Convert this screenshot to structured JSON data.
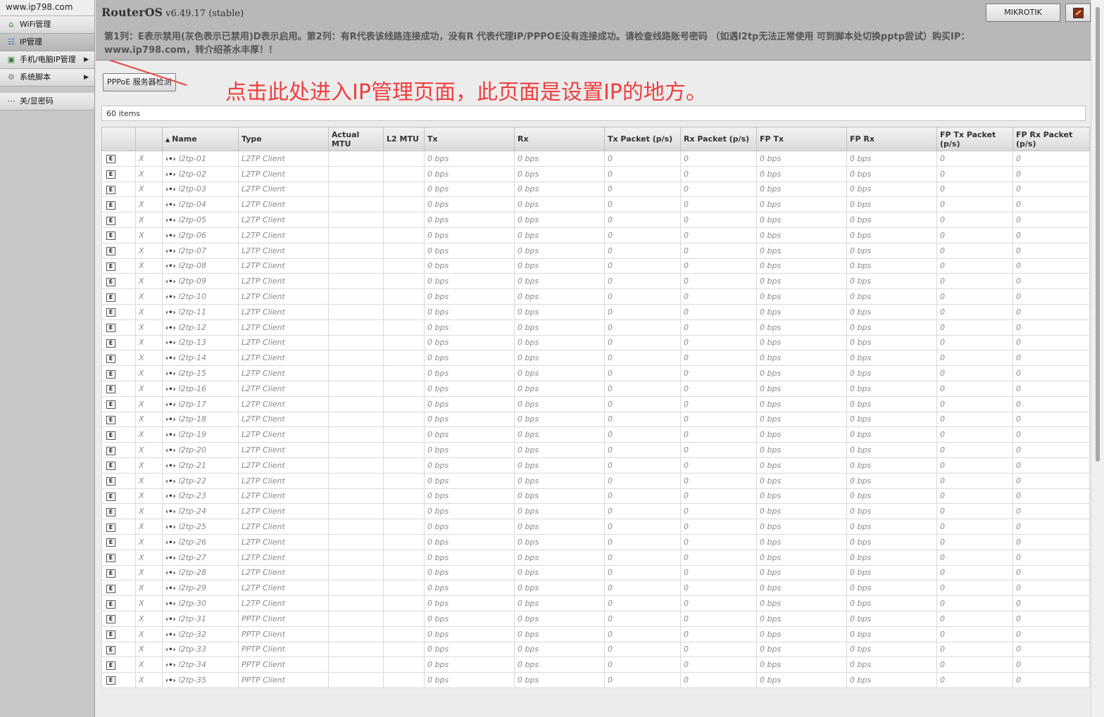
{
  "sidebar": {
    "site": "www.ip798.com",
    "items": [
      {
        "label": "WiFi管理",
        "icon": "wifi-icon",
        "has_submenu": false,
        "active": false
      },
      {
        "label": "IP管理",
        "icon": "network-icon",
        "has_submenu": false,
        "active": true
      },
      {
        "label": "手机/电脑IP管理",
        "icon": "computer-icon",
        "has_submenu": true,
        "active": false
      },
      {
        "label": "系统脚本",
        "icon": "gear-icon",
        "has_submenu": true,
        "active": false
      }
    ],
    "password_item": {
      "label": "关/显密码",
      "icon": "password-dots-icon"
    }
  },
  "header": {
    "title": "RouterOS",
    "version": "v6.49.17 (stable)",
    "identity": "MIKROTIK",
    "notice": "第1列：E表示禁用(灰色表示已禁用)D表示启用。第2列：有R代表该线路连接成功，没有R 代表代理IP/PPPOE没有连接成功。请检查线路账号密码 （如遇l2tp无法正常使用 可到脚本处切换pptp尝试）购买IP：www.ip798.com，转介绍茶水丰厚！！"
  },
  "toolbar": {
    "pppoe_button": "PPPoE 服务器检测"
  },
  "annotation": "点击此处进入IP管理页面，此页面是设置IP的地方。",
  "table": {
    "count_label": "60 items",
    "sort_indicator": "▲",
    "columns": [
      "",
      "",
      "Name",
      "Type",
      "Actual MTU",
      "L2 MTU",
      "Tx",
      "Rx",
      "Tx Packet (p/s)",
      "Rx Packet (p/s)",
      "FP Tx",
      "FP Rx",
      "FP Tx Packet (p/s)",
      "FP Rx Packet (p/s)"
    ],
    "rows": [
      {
        "flag": "X",
        "name": "l2tp-01",
        "type": "L2TP Client",
        "tx": "0 bps",
        "rx": "0 bps",
        "txp": "0",
        "rxp": "0",
        "fptx": "0 bps",
        "fprx": "0 bps",
        "fptxp": "0",
        "fprxp": "0"
      },
      {
        "flag": "X",
        "name": "l2tp-02",
        "type": "L2TP Client",
        "tx": "0 bps",
        "rx": "0 bps",
        "txp": "0",
        "rxp": "0",
        "fptx": "0 bps",
        "fprx": "0 bps",
        "fptxp": "0",
        "fprxp": "0"
      },
      {
        "flag": "X",
        "name": "l2tp-03",
        "type": "L2TP Client",
        "tx": "0 bps",
        "rx": "0 bps",
        "txp": "0",
        "rxp": "0",
        "fptx": "0 bps",
        "fprx": "0 bps",
        "fptxp": "0",
        "fprxp": "0"
      },
      {
        "flag": "X",
        "name": "l2tp-04",
        "type": "L2TP Client",
        "tx": "0 bps",
        "rx": "0 bps",
        "txp": "0",
        "rxp": "0",
        "fptx": "0 bps",
        "fprx": "0 bps",
        "fptxp": "0",
        "fprxp": "0"
      },
      {
        "flag": "X",
        "name": "l2tp-05",
        "type": "L2TP Client",
        "tx": "0 bps",
        "rx": "0 bps",
        "txp": "0",
        "rxp": "0",
        "fptx": "0 bps",
        "fprx": "0 bps",
        "fptxp": "0",
        "fprxp": "0"
      },
      {
        "flag": "X",
        "name": "l2tp-06",
        "type": "L2TP Client",
        "tx": "0 bps",
        "rx": "0 bps",
        "txp": "0",
        "rxp": "0",
        "fptx": "0 bps",
        "fprx": "0 bps",
        "fptxp": "0",
        "fprxp": "0"
      },
      {
        "flag": "X",
        "name": "l2tp-07",
        "type": "L2TP Client",
        "tx": "0 bps",
        "rx": "0 bps",
        "txp": "0",
        "rxp": "0",
        "fptx": "0 bps",
        "fprx": "0 bps",
        "fptxp": "0",
        "fprxp": "0"
      },
      {
        "flag": "X",
        "name": "l2tp-08",
        "type": "L2TP Client",
        "tx": "0 bps",
        "rx": "0 bps",
        "txp": "0",
        "rxp": "0",
        "fptx": "0 bps",
        "fprx": "0 bps",
        "fptxp": "0",
        "fprxp": "0"
      },
      {
        "flag": "X",
        "name": "l2tp-09",
        "type": "L2TP Client",
        "tx": "0 bps",
        "rx": "0 bps",
        "txp": "0",
        "rxp": "0",
        "fptx": "0 bps",
        "fprx": "0 bps",
        "fptxp": "0",
        "fprxp": "0"
      },
      {
        "flag": "X",
        "name": "l2tp-10",
        "type": "L2TP Client",
        "tx": "0 bps",
        "rx": "0 bps",
        "txp": "0",
        "rxp": "0",
        "fptx": "0 bps",
        "fprx": "0 bps",
        "fptxp": "0",
        "fprxp": "0"
      },
      {
        "flag": "X",
        "name": "l2tp-11",
        "type": "L2TP Client",
        "tx": "0 bps",
        "rx": "0 bps",
        "txp": "0",
        "rxp": "0",
        "fptx": "0 bps",
        "fprx": "0 bps",
        "fptxp": "0",
        "fprxp": "0"
      },
      {
        "flag": "X",
        "name": "l2tp-12",
        "type": "L2TP Client",
        "tx": "0 bps",
        "rx": "0 bps",
        "txp": "0",
        "rxp": "0",
        "fptx": "0 bps",
        "fprx": "0 bps",
        "fptxp": "0",
        "fprxp": "0"
      },
      {
        "flag": "X",
        "name": "l2tp-13",
        "type": "L2TP Client",
        "tx": "0 bps",
        "rx": "0 bps",
        "txp": "0",
        "rxp": "0",
        "fptx": "0 bps",
        "fprx": "0 bps",
        "fptxp": "0",
        "fprxp": "0"
      },
      {
        "flag": "X",
        "name": "l2tp-14",
        "type": "L2TP Client",
        "tx": "0 bps",
        "rx": "0 bps",
        "txp": "0",
        "rxp": "0",
        "fptx": "0 bps",
        "fprx": "0 bps",
        "fptxp": "0",
        "fprxp": "0"
      },
      {
        "flag": "X",
        "name": "l2tp-15",
        "type": "L2TP Client",
        "tx": "0 bps",
        "rx": "0 bps",
        "txp": "0",
        "rxp": "0",
        "fptx": "0 bps",
        "fprx": "0 bps",
        "fptxp": "0",
        "fprxp": "0"
      },
      {
        "flag": "X",
        "name": "l2tp-16",
        "type": "L2TP Client",
        "tx": "0 bps",
        "rx": "0 bps",
        "txp": "0",
        "rxp": "0",
        "fptx": "0 bps",
        "fprx": "0 bps",
        "fptxp": "0",
        "fprxp": "0"
      },
      {
        "flag": "X",
        "name": "l2tp-17",
        "type": "L2TP Client",
        "tx": "0 bps",
        "rx": "0 bps",
        "txp": "0",
        "rxp": "0",
        "fptx": "0 bps",
        "fprx": "0 bps",
        "fptxp": "0",
        "fprxp": "0"
      },
      {
        "flag": "X",
        "name": "l2tp-18",
        "type": "L2TP Client",
        "tx": "0 bps",
        "rx": "0 bps",
        "txp": "0",
        "rxp": "0",
        "fptx": "0 bps",
        "fprx": "0 bps",
        "fptxp": "0",
        "fprxp": "0"
      },
      {
        "flag": "X",
        "name": "l2tp-19",
        "type": "L2TP Client",
        "tx": "0 bps",
        "rx": "0 bps",
        "txp": "0",
        "rxp": "0",
        "fptx": "0 bps",
        "fprx": "0 bps",
        "fptxp": "0",
        "fprxp": "0"
      },
      {
        "flag": "X",
        "name": "l2tp-20",
        "type": "L2TP Client",
        "tx": "0 bps",
        "rx": "0 bps",
        "txp": "0",
        "rxp": "0",
        "fptx": "0 bps",
        "fprx": "0 bps",
        "fptxp": "0",
        "fprxp": "0"
      },
      {
        "flag": "X",
        "name": "l2tp-21",
        "type": "L2TP Client",
        "tx": "0 bps",
        "rx": "0 bps",
        "txp": "0",
        "rxp": "0",
        "fptx": "0 bps",
        "fprx": "0 bps",
        "fptxp": "0",
        "fprxp": "0"
      },
      {
        "flag": "X",
        "name": "l2tp-22",
        "type": "L2TP Client",
        "tx": "0 bps",
        "rx": "0 bps",
        "txp": "0",
        "rxp": "0",
        "fptx": "0 bps",
        "fprx": "0 bps",
        "fptxp": "0",
        "fprxp": "0"
      },
      {
        "flag": "X",
        "name": "l2tp-23",
        "type": "L2TP Client",
        "tx": "0 bps",
        "rx": "0 bps",
        "txp": "0",
        "rxp": "0",
        "fptx": "0 bps",
        "fprx": "0 bps",
        "fptxp": "0",
        "fprxp": "0"
      },
      {
        "flag": "X",
        "name": "l2tp-24",
        "type": "L2TP Client",
        "tx": "0 bps",
        "rx": "0 bps",
        "txp": "0",
        "rxp": "0",
        "fptx": "0 bps",
        "fprx": "0 bps",
        "fptxp": "0",
        "fprxp": "0"
      },
      {
        "flag": "X",
        "name": "l2tp-25",
        "type": "L2TP Client",
        "tx": "0 bps",
        "rx": "0 bps",
        "txp": "0",
        "rxp": "0",
        "fptx": "0 bps",
        "fprx": "0 bps",
        "fptxp": "0",
        "fprxp": "0"
      },
      {
        "flag": "X",
        "name": "l2tp-26",
        "type": "L2TP Client",
        "tx": "0 bps",
        "rx": "0 bps",
        "txp": "0",
        "rxp": "0",
        "fptx": "0 bps",
        "fprx": "0 bps",
        "fptxp": "0",
        "fprxp": "0"
      },
      {
        "flag": "X",
        "name": "l2tp-27",
        "type": "L2TP Client",
        "tx": "0 bps",
        "rx": "0 bps",
        "txp": "0",
        "rxp": "0",
        "fptx": "0 bps",
        "fprx": "0 bps",
        "fptxp": "0",
        "fprxp": "0"
      },
      {
        "flag": "X",
        "name": "l2tp-28",
        "type": "L2TP Client",
        "tx": "0 bps",
        "rx": "0 bps",
        "txp": "0",
        "rxp": "0",
        "fptx": "0 bps",
        "fprx": "0 bps",
        "fptxp": "0",
        "fprxp": "0"
      },
      {
        "flag": "X",
        "name": "l2tp-29",
        "type": "L2TP Client",
        "tx": "0 bps",
        "rx": "0 bps",
        "txp": "0",
        "rxp": "0",
        "fptx": "0 bps",
        "fprx": "0 bps",
        "fptxp": "0",
        "fprxp": "0"
      },
      {
        "flag": "X",
        "name": "l2tp-30",
        "type": "L2TP Client",
        "tx": "0 bps",
        "rx": "0 bps",
        "txp": "0",
        "rxp": "0",
        "fptx": "0 bps",
        "fprx": "0 bps",
        "fptxp": "0",
        "fprxp": "0"
      },
      {
        "flag": "X",
        "name": "l2tp-31",
        "type": "PPTP Client",
        "tx": "0 bps",
        "rx": "0 bps",
        "txp": "0",
        "rxp": "0",
        "fptx": "0 bps",
        "fprx": "0 bps",
        "fptxp": "0",
        "fprxp": "0"
      },
      {
        "flag": "X",
        "name": "l2tp-32",
        "type": "PPTP Client",
        "tx": "0 bps",
        "rx": "0 bps",
        "txp": "0",
        "rxp": "0",
        "fptx": "0 bps",
        "fprx": "0 bps",
        "fptxp": "0",
        "fprxp": "0"
      },
      {
        "flag": "X",
        "name": "l2tp-33",
        "type": "PPTP Client",
        "tx": "0 bps",
        "rx": "0 bps",
        "txp": "0",
        "rxp": "0",
        "fptx": "0 bps",
        "fprx": "0 bps",
        "fptxp": "0",
        "fprxp": "0"
      },
      {
        "flag": "X",
        "name": "l2tp-34",
        "type": "PPTP Client",
        "tx": "0 bps",
        "rx": "0 bps",
        "txp": "0",
        "rxp": "0",
        "fptx": "0 bps",
        "fprx": "0 bps",
        "fptxp": "0",
        "fprxp": "0"
      },
      {
        "flag": "X",
        "name": "l2tp-35",
        "type": "PPTP Client",
        "tx": "0 bps",
        "rx": "0 bps",
        "txp": "0",
        "rxp": "0",
        "fptx": "0 bps",
        "fprx": "0 bps",
        "fptxp": "0",
        "fprxp": "0"
      }
    ]
  }
}
